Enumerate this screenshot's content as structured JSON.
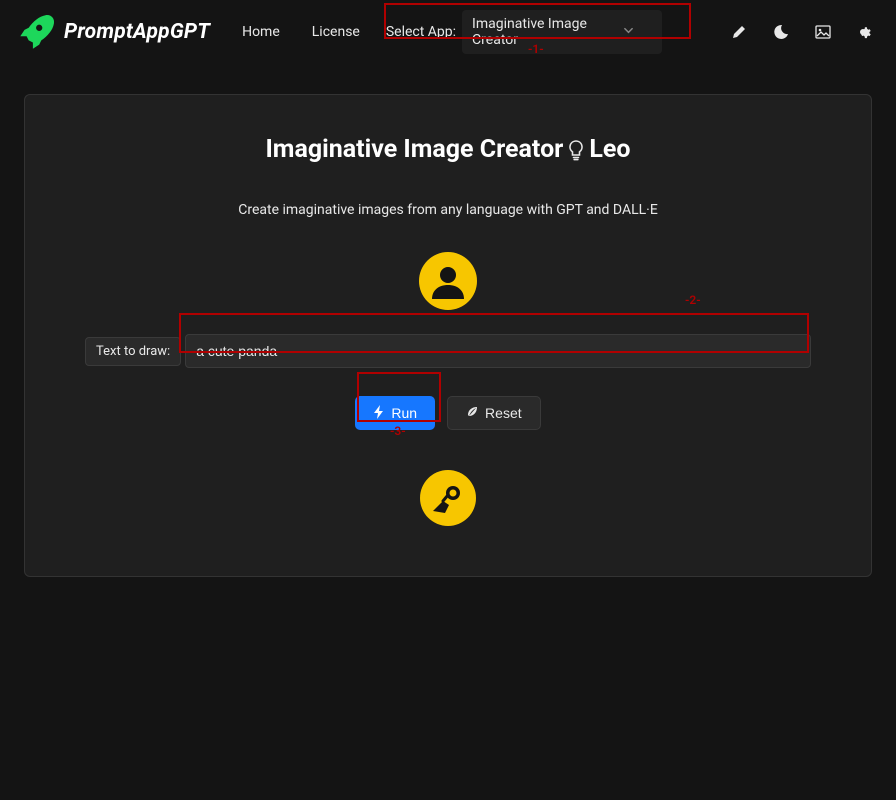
{
  "nav": {
    "brand": "PromptAppGPT",
    "links": [
      "Home",
      "License"
    ],
    "select_label": "Select App:",
    "selected_app": "Imaginative Image Creator",
    "icons": [
      "pencil-icon",
      "moon-icon",
      "image-icon",
      "gear-icon"
    ]
  },
  "annotations": {
    "a1": "-1-",
    "a2": "-2-",
    "a3": "-3-"
  },
  "app": {
    "title_prefix": "Imaginative Image Creator",
    "title_author": "Leo",
    "description": "Create imaginative images from any language with GPT and DALL·E",
    "input_label": "Text to draw:",
    "input_value": "a cute panda",
    "run_label": "Run",
    "reset_label": "Reset"
  },
  "colors": {
    "accent_yellow": "#f7c600",
    "accent_green": "#1dd75b",
    "primary_blue": "#1677ff",
    "annotation_red": "#b00000"
  }
}
